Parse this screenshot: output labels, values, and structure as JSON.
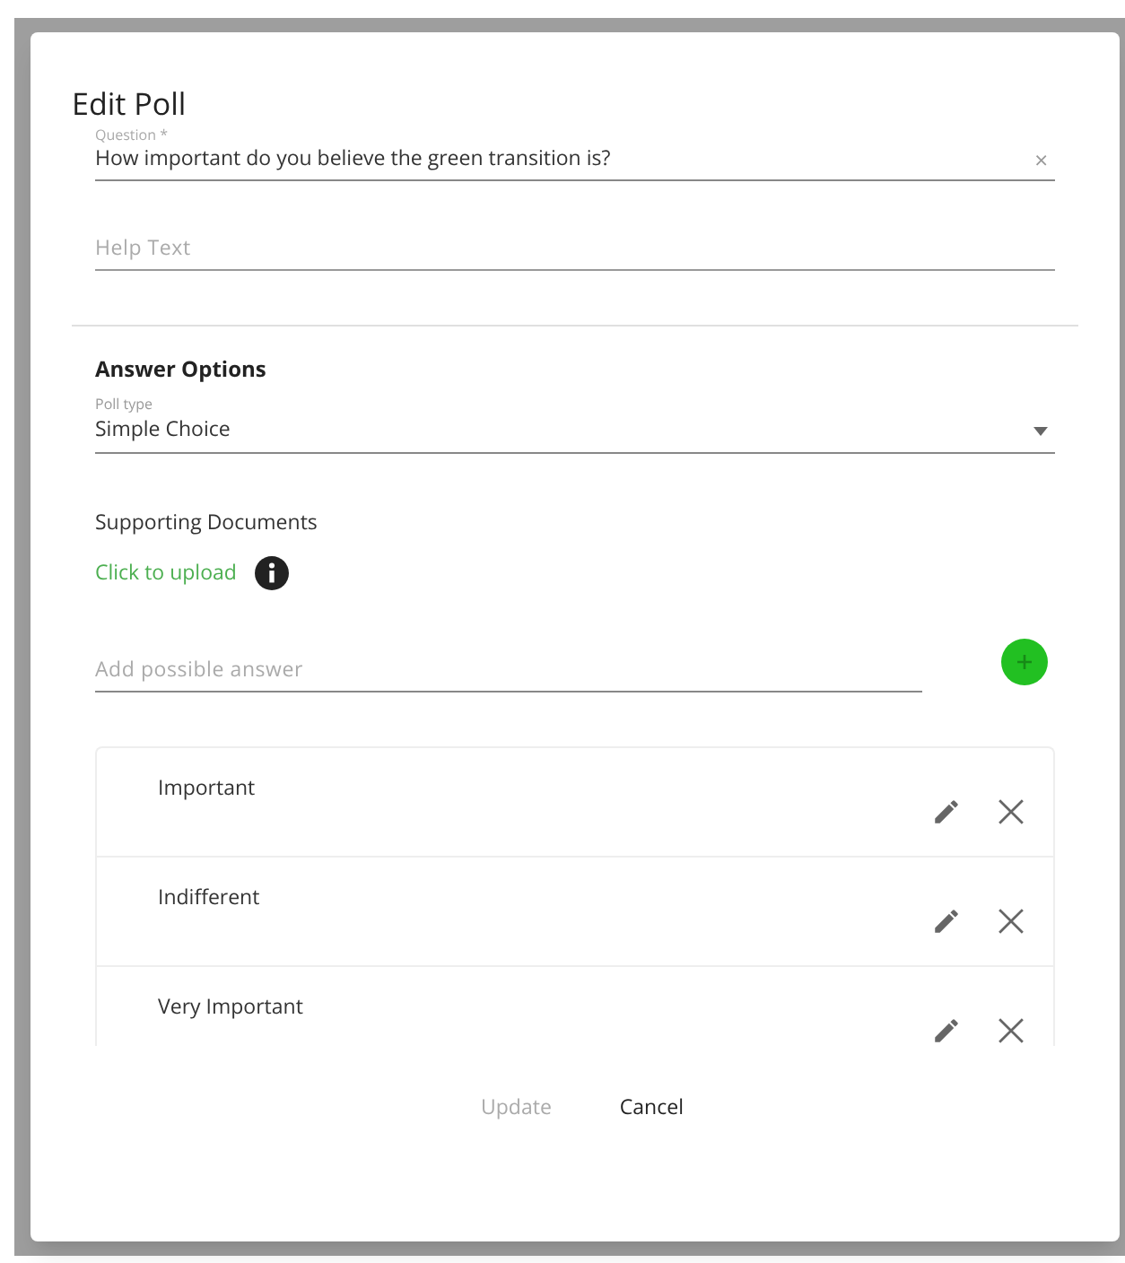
{
  "dialog": {
    "title": "Edit Poll"
  },
  "question": {
    "label": "Question *",
    "value": "How important do you believe the green transition is?",
    "clear": "×"
  },
  "help_text": {
    "placeholder": "Help Text"
  },
  "answer_options": {
    "heading": "Answer Options",
    "poll_type_label": "Poll type",
    "poll_type_value": "Simple Choice"
  },
  "supporting_documents": {
    "label": "Supporting Documents",
    "upload_link": "Click to upload"
  },
  "new_answer": {
    "placeholder": "Add possible answer"
  },
  "answers": [
    {
      "text": "Important"
    },
    {
      "text": "Indifferent"
    },
    {
      "text": "Very Important"
    }
  ],
  "buttons": [
    {
      "label": "Update",
      "disabled": true
    },
    {
      "label": "Cancel",
      "disabled": false
    }
  ]
}
